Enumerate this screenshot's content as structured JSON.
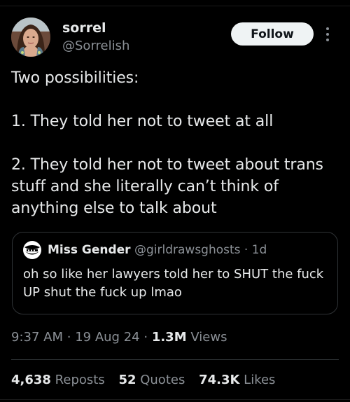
{
  "author": {
    "display_name": "sorrel",
    "handle": "@Sorrelish"
  },
  "follow_button_label": "Follow",
  "tweet_text": "Two possibilities:\n\n1. They told her not to tweet at all\n\n2. They told her not to tweet about trans stuff and she literally can’t think of anything else to talk about",
  "quote": {
    "display_name": "Miss Gender",
    "handle": "@girldrawsghosts",
    "separator": "·",
    "time": "1d",
    "text": "oh so like her lawyers told her to SHUT the fuck UP shut the fuck up lmao"
  },
  "meta": {
    "time": "9:37 AM",
    "separator": "·",
    "date": "19 Aug 24",
    "views_count": "1.3M",
    "views_label": "Views"
  },
  "stats": {
    "reposts_count": "4,638",
    "reposts_label": "Reposts",
    "quotes_count": "52",
    "quotes_label": "Quotes",
    "likes_count": "74.3K",
    "likes_label": "Likes"
  },
  "colors": {
    "background": "#000000",
    "primary_text": "#e7e9ea",
    "secondary_text": "#8b9096",
    "border": "#2f3336",
    "follow_bg": "#eff3f4"
  },
  "icons": {
    "more": "more-vertical-icon"
  }
}
